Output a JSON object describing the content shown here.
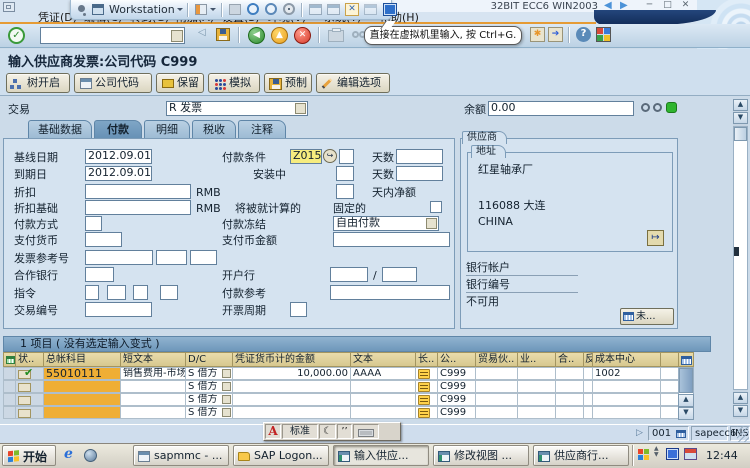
{
  "vm": {
    "workstation": "Workstation",
    "title": "32BIT ECC6 WIN2003",
    "tooltip": "直接在虚拟机里输入, 按 Ctrl+G."
  },
  "menu": {
    "items": [
      "凭证(D)",
      "编辑(C)",
      "转到(G)",
      "附加(A)",
      "设置(S)",
      "环境(V)",
      "系统(Y)",
      "帮助(H)"
    ]
  },
  "screen": {
    "title": "输入供应商发票:公司代码 C999"
  },
  "appbar": {
    "tree": "树开启",
    "company_code": "公司代码",
    "hold": "保留",
    "simulate": "模拟",
    "park": "预制",
    "edit_options": "编辑选项"
  },
  "trans": {
    "label": "交易",
    "value": "R 发票",
    "balance_label": "余额",
    "balance": "0.00"
  },
  "tabs": {
    "basic": "基础数据",
    "payment": "付款",
    "detail": "明细",
    "tax": "税收",
    "note": "注释"
  },
  "pay": {
    "baseline_label": "基线日期",
    "baseline": "2012.09.01",
    "due_label": "到期日",
    "due": "2012.09.01",
    "discount_label": "折扣",
    "currency": "RMB",
    "discount_base_label": "折扣基础",
    "currency2": "RMB",
    "method_label": "付款方式",
    "pay_currency_label": "支付货币",
    "inv_ref_label": "发票参考号",
    "partner_bank_label": "合作银行",
    "instruction_label": "指令",
    "trans_no_label": "交易编号",
    "terms_label": "付款条件",
    "terms": "Z015",
    "days1_label": "天数",
    "days2_label": "天数",
    "installment_label": "安装中",
    "net_days_label": "天内净额",
    "calc_label": "将被就计算的",
    "fixed_label": "固定的",
    "block_label": "付款冻结",
    "block": "自由付款",
    "pay_amount_label": "支付币金额",
    "house_bank_label": "开户行",
    "slash": "/",
    "pay_ref_label": "付款参考",
    "cycle_label": "开票周期"
  },
  "vendor": {
    "panel": "供应商",
    "address": "地址",
    "name": "红星轴承厂",
    "city": "116088 大连",
    "country": "CHINA",
    "bank_account": "银行帐户",
    "bank_number": "银行编号",
    "unavailable": "不可用",
    "open_items": "未..."
  },
  "items": {
    "summary": "1 项目 ( 没有选定输入变式 )",
    "cols": {
      "status": "状..",
      "account": "总帐科目",
      "short_text": "短文本",
      "dc": "D/C",
      "amount": "凭证货币计的金额",
      "text": "文本",
      "long": "长..",
      "company": "公..",
      "trading": "贸易伙..",
      "biz": "业..",
      "partner": "合..",
      "neg": "反",
      "cost_center": "成本中心"
    },
    "rows": [
      {
        "account": "55010111",
        "short_text": "销售费用-市场",
        "dc": "S 借方",
        "amount": "10,000.00",
        "text": "AAAA",
        "company": "C999",
        "cost_center": "1002"
      },
      {
        "account": "",
        "short_text": "",
        "dc": "S 借方",
        "amount": "",
        "text": "",
        "company": "C999",
        "cost_center": ""
      },
      {
        "account": "",
        "short_text": "",
        "dc": "S 借方",
        "amount": "",
        "text": "",
        "company": "C999",
        "cost_center": ""
      },
      {
        "account": "",
        "short_text": "",
        "dc": "S 借方",
        "amount": "",
        "text": "",
        "company": "C999",
        "cost_center": ""
      }
    ]
  },
  "statusbar": {
    "ime_a": "A",
    "ime_label": "标准",
    "session": "001",
    "system": "sapecc6",
    "mode": "INS"
  },
  "taskbar": {
    "start": "开始",
    "b1": "sapmmc - ...",
    "b2": "SAP Logon...",
    "b3": "输入供应...",
    "b4": "修改视图 ...",
    "b5": "供应商行...",
    "clock": "12:44"
  }
}
